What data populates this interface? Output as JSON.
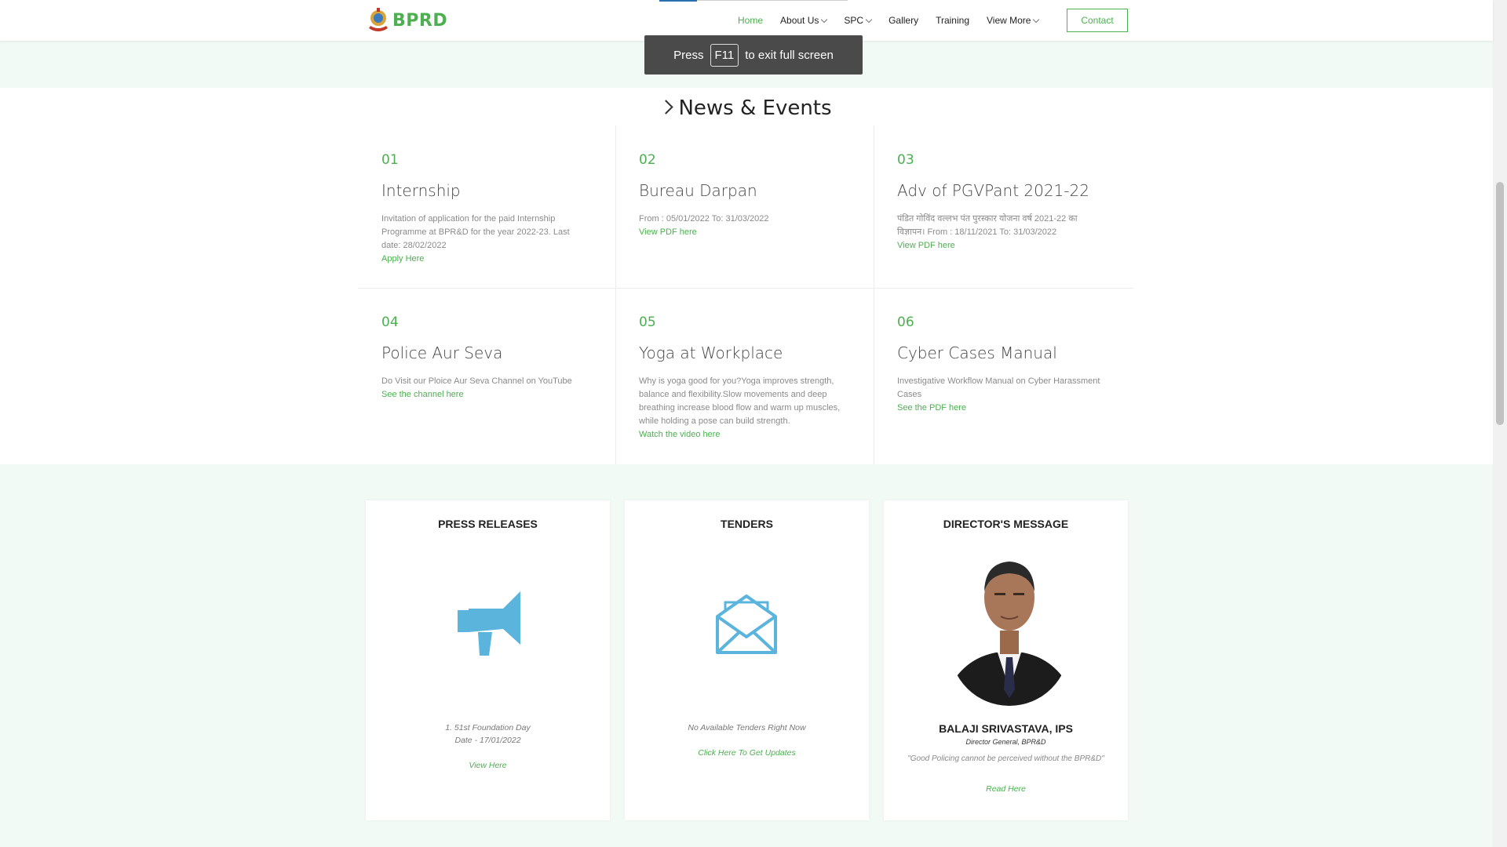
{
  "header": {
    "logo_text": "BPRD",
    "nav": [
      {
        "label": "Home",
        "active": true,
        "dropdown": false
      },
      {
        "label": "About Us",
        "active": false,
        "dropdown": true
      },
      {
        "label": "SPC",
        "active": false,
        "dropdown": true
      },
      {
        "label": "Gallery",
        "active": false,
        "dropdown": false
      },
      {
        "label": "Training",
        "active": false,
        "dropdown": false
      },
      {
        "label": "View More",
        "active": false,
        "dropdown": true
      }
    ],
    "contact_label": "Contact"
  },
  "toast": {
    "before": "Press",
    "key": "F11",
    "after": "to exit full screen"
  },
  "news": {
    "heading": "News & Events",
    "items": [
      {
        "num": "01",
        "title": "Internship",
        "desc": "Invitation of application for the paid Internship Programme at BPR&D for the year 2022-23. Last date: 28/02/2022",
        "link": "Apply Here"
      },
      {
        "num": "02",
        "title": "Bureau Darpan",
        "desc": "From : 05/01/2022 To: 31/03/2022",
        "link": "View PDF here"
      },
      {
        "num": "03",
        "title": "Adv of PGVPant 2021-22",
        "desc": "पंडित गोविंद वल्लभ पंत पुरस्कार योजना वर्ष 2021-22 का विज्ञापन। From : 18/11/2021 To: 31/03/2022",
        "link": "View PDF here"
      },
      {
        "num": "04",
        "title": "Police Aur Seva",
        "desc": "Do Visit our Ploice Aur Seva Channel on YouTube",
        "link": "See the channel here"
      },
      {
        "num": "05",
        "title": "Yoga at Workplace",
        "desc": "Why is yoga good for you?Yoga improves strength, balance and flexibility.Slow movements and deep breathing increase blood flow and warm up muscles, while holding a pose can build strength.",
        "link": "Watch the video here"
      },
      {
        "num": "06",
        "title": "Cyber Cases Manual",
        "desc": "Investigative Workflow Manual on Cyber Harassment Cases",
        "link": "See the PDF here"
      }
    ]
  },
  "cards": {
    "press": {
      "title": "PRESS RELEASES",
      "line1": "1. 51st Foundation Day",
      "line2": "Date - 17/01/2022",
      "link": "View Here",
      "icon": "megaphone-icon"
    },
    "tenders": {
      "title": "TENDERS",
      "text": "No Available Tenders Right Now",
      "link": "Click Here To Get Updates",
      "icon": "envelope-icon"
    },
    "director": {
      "title": "DIRECTOR'S MESSAGE",
      "name": "BALAJI SRIVASTAVA, IPS",
      "role": "Director General, BPR&D",
      "quote": "\"Good Policing cannot be perceived without the BPR&D\"",
      "link": "Read Here"
    }
  },
  "colors": {
    "accent": "#4caf50",
    "icon_blue": "#5ab4dc",
    "mint": "#f1faf5"
  }
}
